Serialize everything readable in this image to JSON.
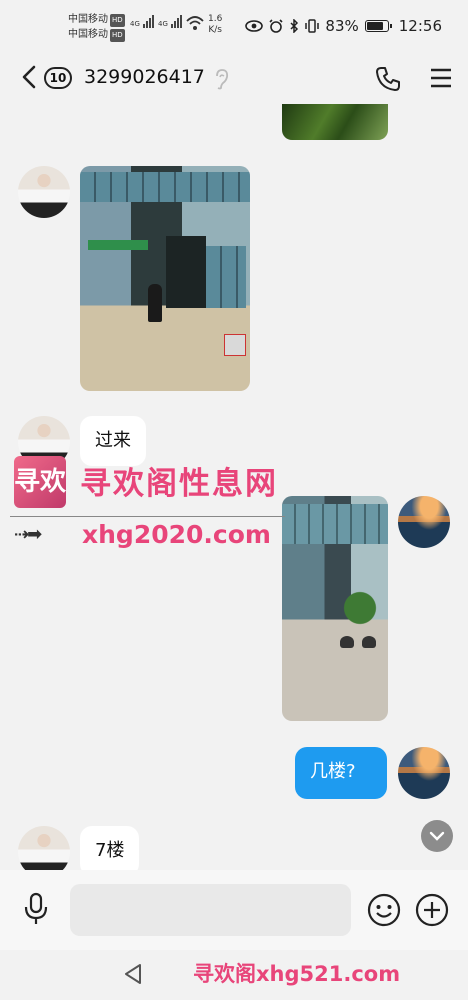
{
  "status_bar": {
    "carrier1": "中国移动",
    "carrier2": "中国移动",
    "hd": "HD",
    "net1": "4G",
    "net2": "4G",
    "speed_value": "1.6",
    "speed_unit": "K/s",
    "battery": "83%",
    "battery_level": 0.83,
    "time": "12:56"
  },
  "header": {
    "unread_count": "10",
    "contact": "3299026417"
  },
  "messages": [
    {
      "type": "image",
      "side": "out",
      "content": "trees photo (partial)"
    },
    {
      "type": "image",
      "side": "in",
      "content": "street storefront photo"
    },
    {
      "type": "text",
      "side": "in",
      "text": "过来"
    },
    {
      "type": "image",
      "side": "out",
      "content": "plaza photo"
    },
    {
      "type": "text",
      "side": "out",
      "text": "几楼?"
    },
    {
      "type": "text",
      "side": "in",
      "text": "7楼"
    }
  ],
  "watermark": {
    "logo_char": "寻欢",
    "title": "寻欢阁性息网",
    "url": "xhg2020.com",
    "bottom": "寻欢阁xhg521.com"
  },
  "input": {
    "placeholder": ""
  },
  "colors": {
    "bubble_out": "#1e9bf0",
    "watermark": "#e8457a"
  }
}
